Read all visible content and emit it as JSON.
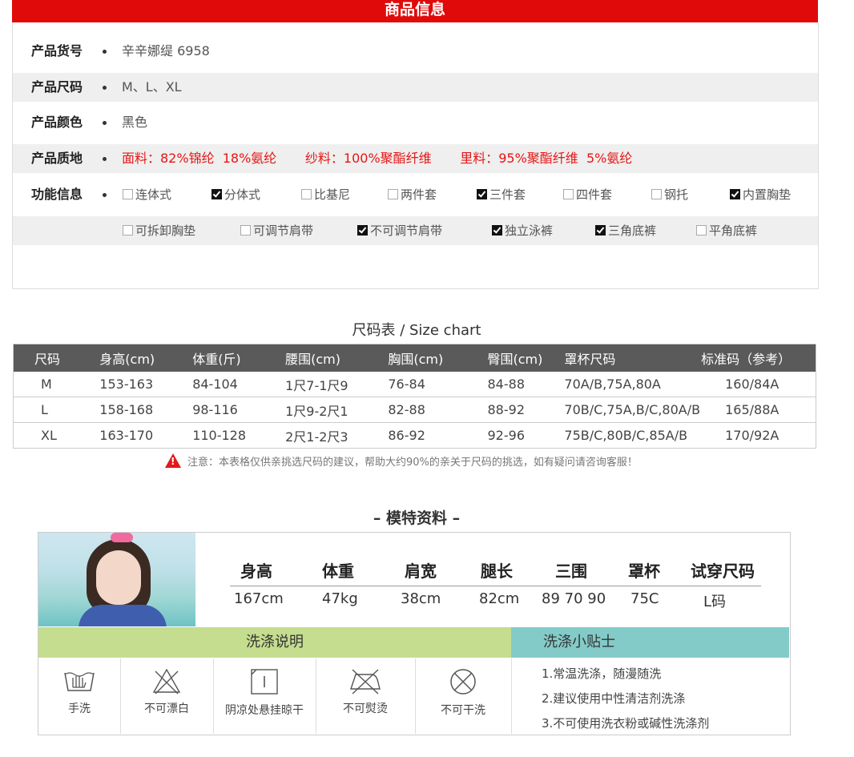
{
  "header": {
    "title": "商品信息"
  },
  "info": [
    {
      "label": "产品货号",
      "value": "辛辛娜缇 6958"
    },
    {
      "label": "产品尺码",
      "value": "M、L、XL"
    },
    {
      "label": "产品颜色",
      "value": "黑色"
    },
    {
      "label": "产品质地",
      "value": "面料：82%锦纶  18%氨纶       纱料：100%聚酯纤维       里料：95%聚酯纤维  5%氨纶"
    }
  ],
  "features": {
    "label": "功能信息",
    "row1": [
      {
        "label": "连体式",
        "checked": false
      },
      {
        "label": "分体式",
        "checked": true
      },
      {
        "label": "比基尼",
        "checked": false
      },
      {
        "label": "两件套",
        "checked": false
      },
      {
        "label": "三件套",
        "checked": true
      },
      {
        "label": "四件套",
        "checked": false
      },
      {
        "label": "钢托",
        "checked": false
      },
      {
        "label": "内置胸垫",
        "checked": true
      }
    ],
    "row2": [
      {
        "label": "可拆卸胸垫",
        "checked": false
      },
      {
        "label": "可调节肩带",
        "checked": false
      },
      {
        "label": "不可调节肩带",
        "checked": true
      },
      {
        "label": "独立泳裤",
        "checked": true
      },
      {
        "label": "三角底裤",
        "checked": true
      },
      {
        "label": "平角底裤",
        "checked": false
      }
    ]
  },
  "size_chart": {
    "title": "尺码表 / Size chart",
    "headers": [
      "尺码",
      "身高(cm)",
      "体重(斤)",
      "腰围(cm)",
      "胸围(cm)",
      "臀围(cm)",
      "罩杯尺码",
      "标准码（参考）"
    ],
    "rows": [
      [
        "M",
        "153-163",
        "84-104",
        "1尺7-1尺9",
        "76-84",
        "84-88",
        "70A/B,75A,80A",
        "160/84A"
      ],
      [
        "L",
        "158-168",
        "98-116",
        "1尺9-2尺1",
        "82-88",
        "88-92",
        "70B/C,75A,B/C,80A/B",
        "165/88A"
      ],
      [
        "XL",
        "163-170",
        "110-128",
        "2尺1-2尺3",
        "86-92",
        "92-96",
        "75B/C,80B/C,85A/B",
        "170/92A"
      ]
    ],
    "note": "注意：本表格仅供亲挑选尺码的建议，帮助大约90%的亲关于尺码的挑选，如有疑问请咨询客服！"
  },
  "model": {
    "title": "– 模特资料 –",
    "headers": [
      "身高",
      "体重",
      "肩宽",
      "腿长",
      "三围",
      "罩杯",
      "试穿尺码"
    ],
    "values": [
      "167cm",
      "47kg",
      "38cm",
      "82cm",
      "89 70 90",
      "75C",
      "L码"
    ]
  },
  "wash": {
    "title": "洗涤说明",
    "items": [
      {
        "icon": "hand-wash-icon",
        "label": "手洗"
      },
      {
        "icon": "no-bleach-icon",
        "label": "不可漂白"
      },
      {
        "icon": "line-dry-shade-icon",
        "label": "阴凉处悬挂晾干"
      },
      {
        "icon": "no-iron-icon",
        "label": "不可熨烫"
      },
      {
        "icon": "no-dry-clean-icon",
        "label": "不可干洗"
      }
    ]
  },
  "tips": {
    "title": "洗涤小贴士",
    "items": [
      "1.常温洗涤，随漫随洗",
      "2.建议使用中性清洁剂洗涤",
      "3.不可使用洗衣粉或碱性洗涤剂"
    ]
  },
  "colors": {
    "header_red": "#e00a0a",
    "wash_green": "#c5dd8f",
    "tip_teal": "#83cbc8",
    "table_header": "#5a5a5a"
  }
}
